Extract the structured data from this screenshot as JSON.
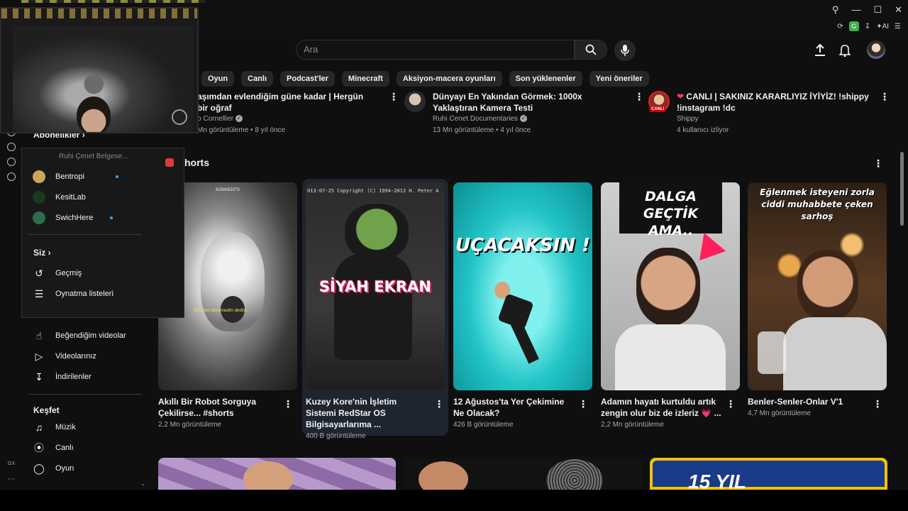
{
  "search": {
    "placeholder": "Ara"
  },
  "chips": [
    "Oyun",
    "Canlı",
    "Podcast'ler",
    "Minecraft",
    "Aksiyon-macera oyunları",
    "Son yüklenenler",
    "Yeni öneriler"
  ],
  "extensions": {
    "g_label": "G",
    "ai_label": "AI"
  },
  "sidebar": {
    "subscriptions_title": "Abonelikler",
    "channels_partial": "Ruhi Çenet Belgese...",
    "channels": [
      {
        "name": "Bentropi",
        "live": true,
        "color": "#caa65a"
      },
      {
        "name": "KesitLab",
        "live": false,
        "color": "#1a3a1f"
      },
      {
        "name": "SwichHere",
        "live": true,
        "color": "#2e6b4b"
      }
    ],
    "you_title": "Siz",
    "you_items": [
      {
        "label": "Geçmiş",
        "icon": "history-icon"
      },
      {
        "label": "Oynatma listeleri",
        "icon": "playlist-icon"
      },
      {
        "label": "Beğendiğim videolar",
        "icon": "thumbs-up-icon"
      },
      {
        "label": "Videolarınız",
        "icon": "your-videos-icon"
      },
      {
        "label": "İndirilenler",
        "icon": "download-icon"
      }
    ],
    "explore_title": "Keşfet",
    "explore_items": [
      {
        "label": "Müzik",
        "icon": "music-icon"
      },
      {
        "label": "Canlı",
        "icon": "live-icon"
      },
      {
        "label": "Oyun",
        "icon": "gaming-icon"
      }
    ],
    "rail_label": "GX"
  },
  "top_videos": [
    {
      "title": "aşımdan evlendiğim güne kadar | Hergün bir oğraf",
      "channel": "o Cornellier",
      "meta": "Mn görüntüleme • 8 yıl önce",
      "verified": true
    },
    {
      "title": "Dünyayı En Yakından Görmek: 1000x Yaklaştıran Kamera Testi",
      "channel": "Ruhi Cenet Documentaries",
      "meta": "13 Mn görüntüleme • 4 yıl önce",
      "verified": true
    },
    {
      "title": "CANLI | SAKINIZ KARARLIYIZ İYİYİZ! !shippy !instagram !dc",
      "channel": "Shippy",
      "meta": "4 kullanıcı izliyor",
      "verified": false,
      "live_badge": "CANLI"
    }
  ],
  "shorts_title": "Shorts",
  "shorts_title_visible": "horts",
  "shorts": [
    {
      "title": "Akıllı Bir Robot Sorguya Çekilirse... #shorts",
      "views": "2,2 Mn görüntüleme",
      "overlay": "Onu ben öldürmedim dedim..",
      "watermark": "KOMAENTS"
    },
    {
      "title": "Kuzey Kore'nin İşletim Sistemi RedStar OS Bilgisayarlarıma ...",
      "views": "400 B görüntüleme",
      "overlay": "SİYAH EKRAN",
      "header_text": "013-07-25 Copyright (C) 1994-2013 H. Peter A"
    },
    {
      "title": "12 Ağustos'ta Yer Çekimine Ne Olacak?",
      "views": "426 B görüntüleme",
      "overlay": "UÇACAKSIN !"
    },
    {
      "title": "Adamın hayatı kurtuldu artık zengin olur biz de izleriz 💗 ...",
      "views": "2,2 Mn görüntüleme",
      "overlay": "DALGA GEÇTİK AMA.."
    },
    {
      "title": "Benler-Senler-Onlar V'1",
      "views": "4,7 Mn görüntüleme",
      "overlay": "Eğlenmek isteyeni zorla ciddi muhabbete çeken sarhoş"
    }
  ],
  "bottom_thumb_text": "15 YIL"
}
